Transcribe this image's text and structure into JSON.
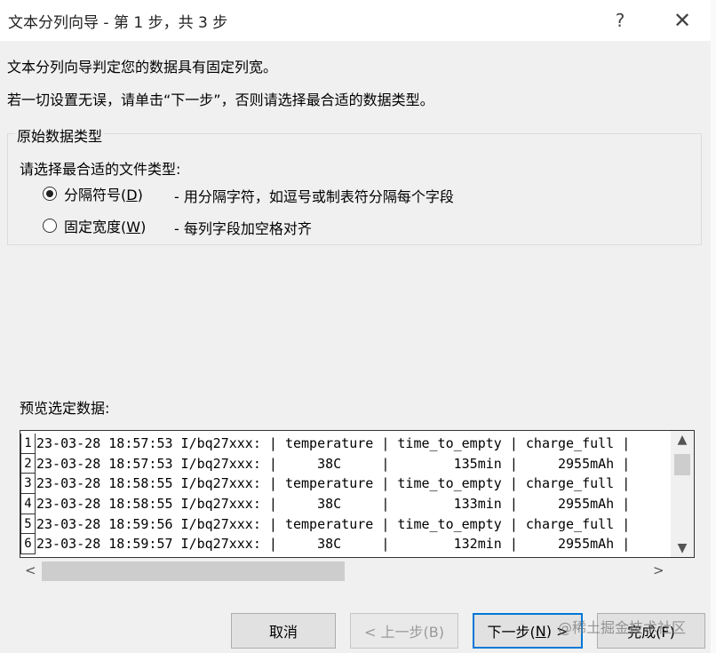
{
  "dialog": {
    "title": "文本分列向导 - 第 1 步，共 3 步",
    "help": "?",
    "close": "✕"
  },
  "intro": {
    "line1": "文本分列向导判定您的数据具有固定列宽。",
    "line2": "若一切设置无误，请单击“下一步”，否则请选择最合适的数据类型。"
  },
  "original_type": {
    "group_title": "原始数据类型",
    "prompt": "请选择最合适的文件类型:",
    "options": [
      {
        "label": "分隔符号(",
        "key": "D",
        "suffix": ")",
        "desc": "- 用分隔字符，如逗号或制表符分隔每个字段",
        "selected": true
      },
      {
        "label": "固定宽度(",
        "key": "W",
        "suffix": ")",
        "desc": "- 每列字段加空格对齐",
        "selected": false
      }
    ]
  },
  "preview": {
    "label": "预览选定数据:",
    "rows": [
      {
        "n": "1",
        "text": "23-03-28 18:57:53 I/bq27xxx: | temperature | time_to_empty | charge_full |"
      },
      {
        "n": "2",
        "text": "23-03-28 18:57:53 I/bq27xxx: |     38C     |        135min |     2955mAh |"
      },
      {
        "n": "3",
        "text": "23-03-28 18:58:55 I/bq27xxx: | temperature | time_to_empty | charge_full |"
      },
      {
        "n": "4",
        "text": "23-03-28 18:58:55 I/bq27xxx: |     38C     |        133min |     2955mAh |"
      },
      {
        "n": "5",
        "text": "23-03-28 18:59:56 I/bq27xxx: | temperature | time_to_empty | charge_full |"
      },
      {
        "n": "6",
        "text": "23-03-28 18:59:57 I/bq27xxx: |     38C     |        132min |     2955mAh |"
      }
    ]
  },
  "buttons": {
    "cancel": "取消",
    "back": "< 上一步(B)",
    "next_label": "下一步(",
    "next_key": "N",
    "next_suffix": ") >",
    "finish": "完成(F)"
  },
  "watermark": "@稀土掘金技术社区",
  "icons": {
    "scroll_up": "▲",
    "scroll_down": "▼",
    "scroll_left": "<",
    "scroll_right": ">"
  }
}
